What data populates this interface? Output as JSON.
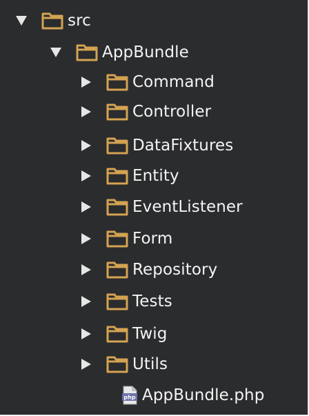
{
  "tree": {
    "root": {
      "label": "src"
    },
    "bundle": {
      "label": "AppBundle"
    },
    "folders": [
      {
        "label": "Command"
      },
      {
        "label": "Controller"
      },
      {
        "label": "DataFixtures"
      },
      {
        "label": "Entity"
      },
      {
        "label": "EventListener"
      },
      {
        "label": "Form"
      },
      {
        "label": "Repository"
      },
      {
        "label": "Tests"
      },
      {
        "label": "Twig"
      },
      {
        "label": "Utils"
      }
    ],
    "file": {
      "label": "AppBundle.php",
      "icon_text": "php"
    }
  },
  "colors": {
    "background": "#2b2c2e",
    "folder": "#d4a352",
    "arrow": "#e6e6e6",
    "text": "#f4f4f4",
    "php_badge": "#6b73a8"
  }
}
